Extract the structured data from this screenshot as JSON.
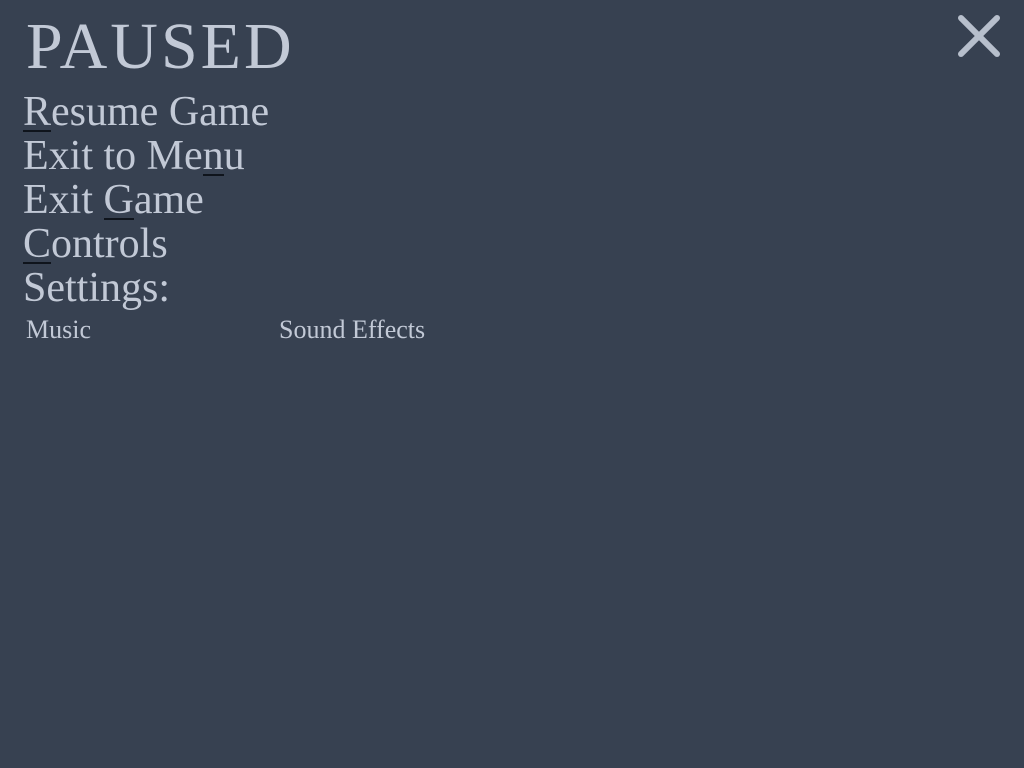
{
  "pause_menu": {
    "title": "PAUSED",
    "close_icon": "close-x-icon",
    "items": [
      {
        "pre": "",
        "accel": "R",
        "post": "esume Game"
      },
      {
        "pre": "Exit to Me",
        "accel": "n",
        "post": "u"
      },
      {
        "pre": "Exit ",
        "accel": "G",
        "post": "ame"
      },
      {
        "pre": "",
        "accel": "C",
        "post": "ontrols"
      }
    ],
    "settings_label": "Settings:",
    "settings": {
      "music_label": "Music",
      "sfx_label": "Sound Effects"
    }
  },
  "colors": {
    "background": "#374151",
    "text": "#c2c9d6",
    "underline": "#0f141c"
  }
}
